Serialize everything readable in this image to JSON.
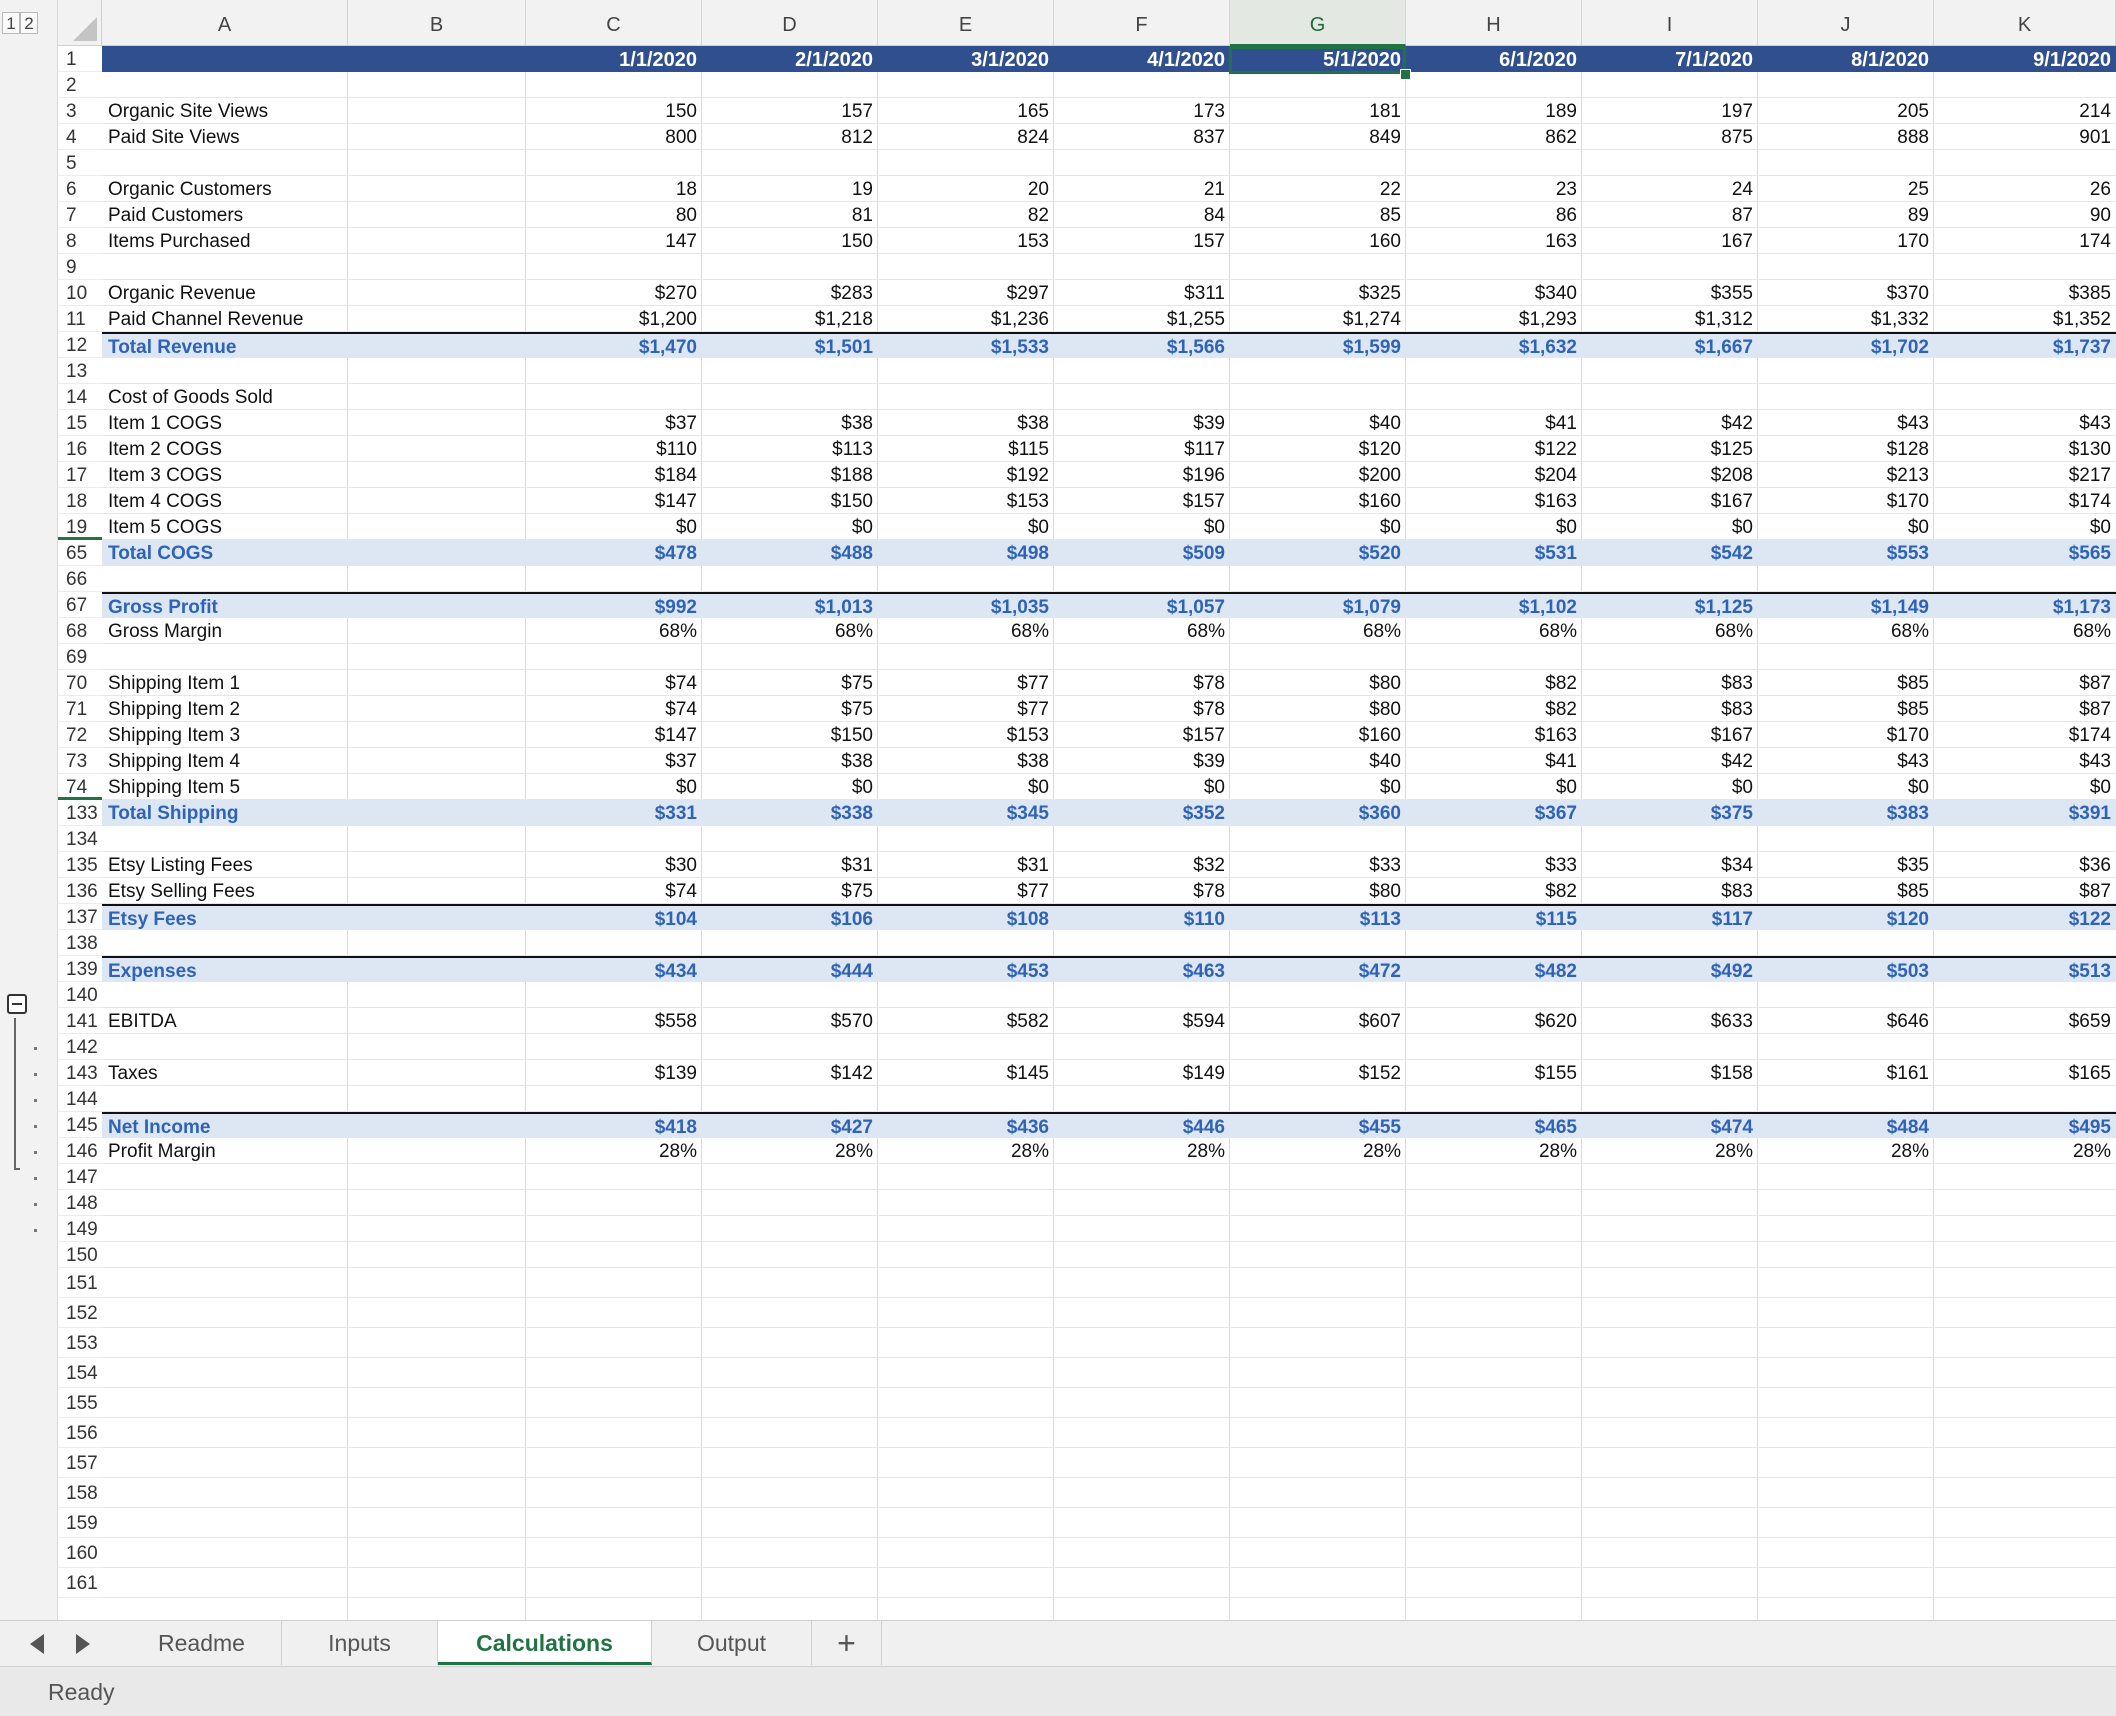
{
  "outline_levels": [
    "1",
    "2"
  ],
  "columns": [
    "A",
    "B",
    "C",
    "D",
    "E",
    "F",
    "G",
    "H",
    "I",
    "J",
    "K"
  ],
  "selected_column": "G",
  "selected_cell": "G1",
  "rows": [
    {
      "n": "1",
      "style": "header",
      "label": "",
      "values": [
        "1/1/2020",
        "2/1/2020",
        "3/1/2020",
        "4/1/2020",
        "5/1/2020",
        "6/1/2020",
        "7/1/2020",
        "8/1/2020",
        "9/1/2020"
      ]
    },
    {
      "n": "2",
      "style": "",
      "label": "",
      "values": []
    },
    {
      "n": "3",
      "style": "",
      "label": "Organic Site Views",
      "values": [
        "150",
        "157",
        "165",
        "173",
        "181",
        "189",
        "197",
        "205",
        "214"
      ]
    },
    {
      "n": "4",
      "style": "",
      "label": "Paid Site Views",
      "values": [
        "800",
        "812",
        "824",
        "837",
        "849",
        "862",
        "875",
        "888",
        "901"
      ]
    },
    {
      "n": "5",
      "style": "",
      "label": "",
      "values": []
    },
    {
      "n": "6",
      "style": "",
      "label": "Organic Customers",
      "values": [
        "18",
        "19",
        "20",
        "21",
        "22",
        "23",
        "24",
        "25",
        "26"
      ]
    },
    {
      "n": "7",
      "style": "",
      "label": "Paid Customers",
      "values": [
        "80",
        "81",
        "82",
        "84",
        "85",
        "86",
        "87",
        "89",
        "90"
      ]
    },
    {
      "n": "8",
      "style": "",
      "label": "Items Purchased",
      "values": [
        "147",
        "150",
        "153",
        "157",
        "160",
        "163",
        "167",
        "170",
        "174"
      ]
    },
    {
      "n": "9",
      "style": "",
      "label": "",
      "values": []
    },
    {
      "n": "10",
      "style": "",
      "label": "Organic Revenue",
      "values": [
        "$270",
        "$283",
        "$297",
        "$311",
        "$325",
        "$340",
        "$355",
        "$370",
        "$385"
      ]
    },
    {
      "n": "11",
      "style": "",
      "label": "Paid Channel Revenue",
      "values": [
        "$1,200",
        "$1,218",
        "$1,236",
        "$1,255",
        "$1,274",
        "$1,293",
        "$1,312",
        "$1,332",
        "$1,352"
      ]
    },
    {
      "n": "12",
      "style": "total",
      "label": "Total Revenue",
      "values": [
        "$1,470",
        "$1,501",
        "$1,533",
        "$1,566",
        "$1,599",
        "$1,632",
        "$1,667",
        "$1,702",
        "$1,737"
      ]
    },
    {
      "n": "13",
      "style": "",
      "label": "",
      "values": []
    },
    {
      "n": "14",
      "style": "",
      "label": "Cost of Goods Sold",
      "values": []
    },
    {
      "n": "15",
      "style": "",
      "label": "Item 1 COGS",
      "values": [
        "$37",
        "$38",
        "$38",
        "$39",
        "$40",
        "$41",
        "$42",
        "$43",
        "$43"
      ]
    },
    {
      "n": "16",
      "style": "",
      "label": "Item 2 COGS",
      "values": [
        "$110",
        "$113",
        "$115",
        "$117",
        "$120",
        "$122",
        "$125",
        "$128",
        "$130"
      ]
    },
    {
      "n": "17",
      "style": "",
      "label": "Item 3 COGS",
      "values": [
        "$184",
        "$188",
        "$192",
        "$196",
        "$200",
        "$204",
        "$208",
        "$213",
        "$217"
      ]
    },
    {
      "n": "18",
      "style": "",
      "label": "Item 4 COGS",
      "values": [
        "$147",
        "$150",
        "$153",
        "$157",
        "$160",
        "$163",
        "$167",
        "$170",
        "$174"
      ]
    },
    {
      "n": "19",
      "style": "split",
      "label": "Item 5 COGS",
      "values": [
        "$0",
        "$0",
        "$0",
        "$0",
        "$0",
        "$0",
        "$0",
        "$0",
        "$0"
      ]
    },
    {
      "n": "65",
      "style": "total",
      "label": "Total COGS",
      "values": [
        "$478",
        "$488",
        "$498",
        "$509",
        "$520",
        "$531",
        "$542",
        "$553",
        "$565"
      ]
    },
    {
      "n": "66",
      "style": "",
      "label": "",
      "values": []
    },
    {
      "n": "67",
      "style": "total",
      "label": "Gross Profit",
      "values": [
        "$992",
        "$1,013",
        "$1,035",
        "$1,057",
        "$1,079",
        "$1,102",
        "$1,125",
        "$1,149",
        "$1,173"
      ]
    },
    {
      "n": "68",
      "style": "",
      "label": "Gross Margin",
      "values": [
        "68%",
        "68%",
        "68%",
        "68%",
        "68%",
        "68%",
        "68%",
        "68%",
        "68%"
      ]
    },
    {
      "n": "69",
      "style": "",
      "label": "",
      "values": []
    },
    {
      "n": "70",
      "style": "",
      "label": "Shipping Item 1",
      "values": [
        "$74",
        "$75",
        "$77",
        "$78",
        "$80",
        "$82",
        "$83",
        "$85",
        "$87"
      ]
    },
    {
      "n": "71",
      "style": "",
      "label": "Shipping Item 2",
      "values": [
        "$74",
        "$75",
        "$77",
        "$78",
        "$80",
        "$82",
        "$83",
        "$85",
        "$87"
      ]
    },
    {
      "n": "72",
      "style": "",
      "label": "Shipping Item 3",
      "values": [
        "$147",
        "$150",
        "$153",
        "$157",
        "$160",
        "$163",
        "$167",
        "$170",
        "$174"
      ]
    },
    {
      "n": "73",
      "style": "",
      "label": "Shipping Item 4",
      "values": [
        "$37",
        "$38",
        "$38",
        "$39",
        "$40",
        "$41",
        "$42",
        "$43",
        "$43"
      ]
    },
    {
      "n": "74",
      "style": "split",
      "label": "Shipping Item 5",
      "values": [
        "$0",
        "$0",
        "$0",
        "$0",
        "$0",
        "$0",
        "$0",
        "$0",
        "$0"
      ]
    },
    {
      "n": "133",
      "style": "total",
      "label": "Total Shipping",
      "values": [
        "$331",
        "$338",
        "$345",
        "$352",
        "$360",
        "$367",
        "$375",
        "$383",
        "$391"
      ]
    },
    {
      "n": "134",
      "style": "",
      "label": "",
      "values": []
    },
    {
      "n": "135",
      "style": "",
      "label": "Etsy Listing Fees",
      "values": [
        "$30",
        "$31",
        "$31",
        "$32",
        "$33",
        "$33",
        "$34",
        "$35",
        "$36"
      ]
    },
    {
      "n": "136",
      "style": "",
      "label": "Etsy Selling Fees",
      "values": [
        "$74",
        "$75",
        "$77",
        "$78",
        "$80",
        "$82",
        "$83",
        "$85",
        "$87"
      ]
    },
    {
      "n": "137",
      "style": "total",
      "label": "Etsy Fees",
      "values": [
        "$104",
        "$106",
        "$108",
        "$110",
        "$113",
        "$115",
        "$117",
        "$120",
        "$122"
      ]
    },
    {
      "n": "138",
      "style": "",
      "label": "",
      "values": []
    },
    {
      "n": "139",
      "style": "total",
      "label": "Expenses",
      "values": [
        "$434",
        "$444",
        "$453",
        "$463",
        "$472",
        "$482",
        "$492",
        "$503",
        "$513"
      ]
    },
    {
      "n": "140",
      "style": "",
      "label": "",
      "values": []
    },
    {
      "n": "141",
      "style": "",
      "label": "EBITDA",
      "values": [
        "$558",
        "$570",
        "$582",
        "$594",
        "$607",
        "$620",
        "$633",
        "$646",
        "$659"
      ]
    },
    {
      "n": "142",
      "style": "",
      "label": "",
      "values": []
    },
    {
      "n": "143",
      "style": "",
      "label": "Taxes",
      "values": [
        "$139",
        "$142",
        "$145",
        "$149",
        "$152",
        "$155",
        "$158",
        "$161",
        "$165"
      ]
    },
    {
      "n": "144",
      "style": "",
      "label": "",
      "values": []
    },
    {
      "n": "145",
      "style": "total",
      "label": "Net Income",
      "values": [
        "$418",
        "$427",
        "$436",
        "$446",
        "$455",
        "$465",
        "$474",
        "$484",
        "$495"
      ]
    },
    {
      "n": "146",
      "style": "",
      "label": "Profit Margin",
      "values": [
        "28%",
        "28%",
        "28%",
        "28%",
        "28%",
        "28%",
        "28%",
        "28%",
        "28%"
      ]
    },
    {
      "n": "147",
      "style": "",
      "label": "",
      "values": []
    },
    {
      "n": "148",
      "style": "",
      "label": "",
      "values": []
    },
    {
      "n": "149",
      "style": "",
      "label": "",
      "values": []
    },
    {
      "n": "150",
      "style": "",
      "label": "",
      "values": []
    },
    {
      "n": "151",
      "style": "",
      "label": "",
      "values": []
    },
    {
      "n": "152",
      "style": "",
      "label": "",
      "values": []
    },
    {
      "n": "153",
      "style": "",
      "label": "",
      "values": []
    },
    {
      "n": "154",
      "style": "",
      "label": "",
      "values": []
    },
    {
      "n": "155",
      "style": "",
      "label": "",
      "values": []
    },
    {
      "n": "156",
      "style": "",
      "label": "",
      "values": []
    },
    {
      "n": "157",
      "style": "",
      "label": "",
      "values": []
    },
    {
      "n": "158",
      "style": "",
      "label": "",
      "values": []
    },
    {
      "n": "159",
      "style": "",
      "label": "",
      "values": []
    },
    {
      "n": "160",
      "style": "",
      "label": "",
      "values": []
    },
    {
      "n": "161",
      "style": "",
      "label": "",
      "values": []
    }
  ],
  "sheet_tabs": [
    {
      "label": "Readme",
      "active": false
    },
    {
      "label": "Inputs",
      "active": false
    },
    {
      "label": "Calculations",
      "active": true
    },
    {
      "label": "Output",
      "active": false
    }
  ],
  "add_sheet_label": "+",
  "status": "Ready",
  "colors": {
    "header_bar": "#2f4f8f",
    "total_text": "#2e63b8",
    "total_fill": "#dde6f3",
    "accent": "#217346"
  },
  "icons": {
    "outline_collapse": "minus-box-icon",
    "prev_sheet": "triangle-left-icon",
    "next_sheet": "triangle-right-icon"
  }
}
